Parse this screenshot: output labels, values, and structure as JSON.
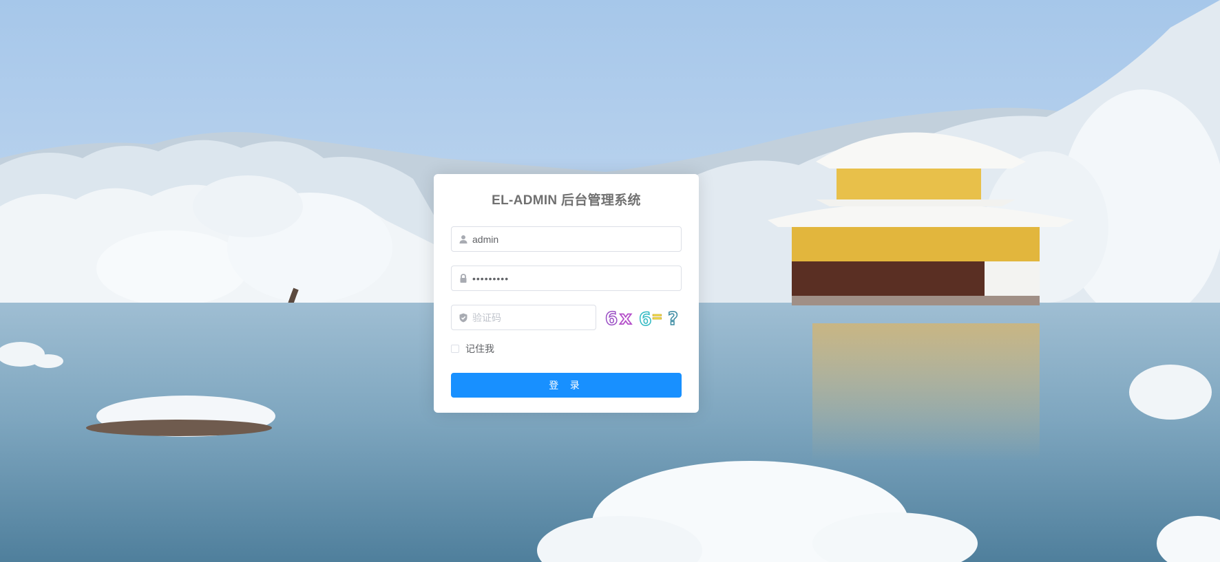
{
  "app": {
    "title": "EL-ADMIN 后台管理系统"
  },
  "login": {
    "username_value": "admin",
    "username_icon": "user-icon",
    "password_value": "•••••••••",
    "password_icon": "lock-icon",
    "code_placeholder": "验证码",
    "code_icon": "shield-icon",
    "captcha_text": "6x6=?",
    "remember_label": "记住我",
    "remember_checked": false,
    "submit_label": "登 录"
  },
  "colors": {
    "primary": "#1890ff",
    "title": "#707070",
    "border": "#dcdfe6",
    "placeholder": "#c0c4cc"
  },
  "background": {
    "scene": "snowy-temple-lake"
  }
}
